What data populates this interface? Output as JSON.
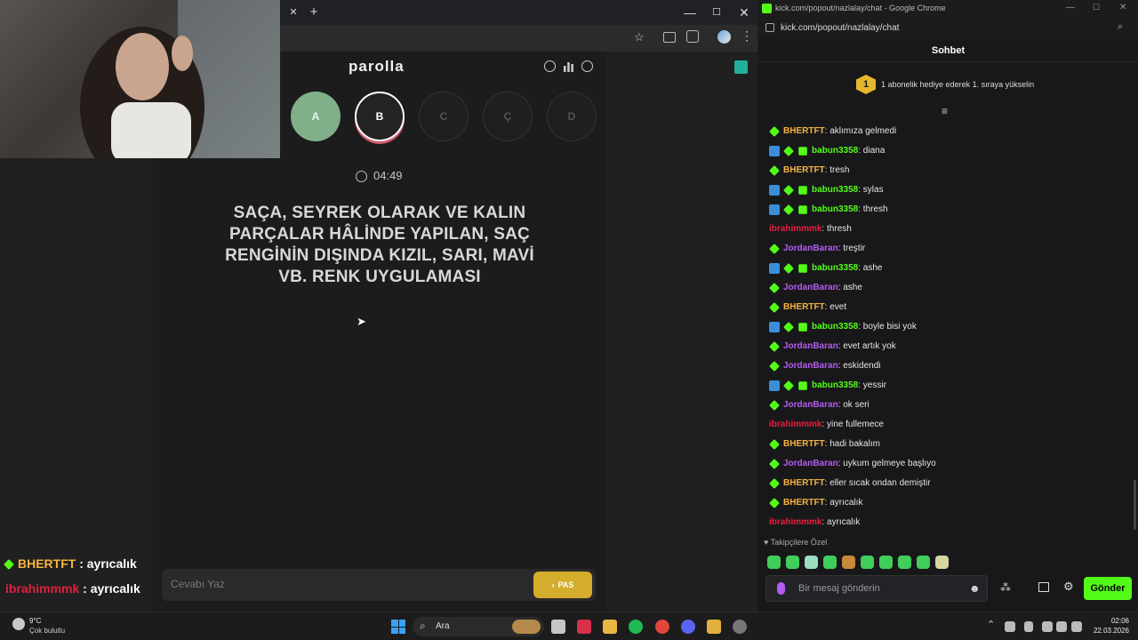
{
  "left_browser": {
    "window_controls": {
      "minimize": "—",
      "maximize": "☐",
      "close": "✕"
    },
    "tab_close": "✕",
    "new_tab": "+"
  },
  "game": {
    "title": "parolla",
    "options": [
      "A",
      "B",
      "C",
      "Ç",
      "D"
    ],
    "timer": "04:49",
    "question_lines": [
      "SAÇA, SEYREK OLARAK VE KALIN",
      "PARÇALAR HÂLİNDE YAPILAN, SAÇ",
      "RENGİNİN DIŞINDA KIZIL, SARI, MAVİ",
      "VB. RENK UYGULAMASI"
    ],
    "answer_placeholder": "Cevabı Yaz",
    "pass_button": "PAS",
    "colors": {
      "option_done": "#7fb08a",
      "option_active": "#ffffff",
      "pass": "#d4ad2c"
    }
  },
  "overlay_chat": [
    {
      "user": "BHERTFT",
      "text": " : ayrıcalık",
      "color": "#f5b540"
    },
    {
      "user": "ibrahimmmk",
      "text": " : ayrıcalık",
      "color": "#e0213f"
    }
  ],
  "chat": {
    "window_title": "kick.com/popout/nazlalay/chat - Google Chrome",
    "url": "kick.com/popout/nazlalay/chat",
    "header": "Sohbet",
    "gift_rank": "1",
    "gift_text": "1 abonelik hediye ederek 1. sıraya yükselin",
    "messages": [
      {
        "user": "BHERTFT",
        "color": "#f5b540",
        "badges": [
          "diamond"
        ],
        "text": ": aklımıza gelmedi"
      },
      {
        "user": "babun3358",
        "color": "#53fc18",
        "badges": [
          "pin",
          "diamond",
          "gift"
        ],
        "text": ": diana"
      },
      {
        "user": "BHERTFT",
        "color": "#f5b540",
        "badges": [
          "diamond"
        ],
        "text": ": tresh"
      },
      {
        "user": "babun3358",
        "color": "#53fc18",
        "badges": [
          "pin",
          "diamond",
          "gift"
        ],
        "text": ": sylas"
      },
      {
        "user": "babun3358",
        "color": "#53fc18",
        "badges": [
          "pin",
          "diamond",
          "gift"
        ],
        "text": ": thresh"
      },
      {
        "user": "ibrahimmmk",
        "color": "#e0213f",
        "badges": [],
        "text": ": thresh"
      },
      {
        "user": "JordanBaran",
        "color": "#b45cf0",
        "badges": [
          "diamond"
        ],
        "text": ": treştir"
      },
      {
        "user": "babun3358",
        "color": "#53fc18",
        "badges": [
          "pin",
          "diamond",
          "gift"
        ],
        "text": ": ashe"
      },
      {
        "user": "JordanBaran",
        "color": "#b45cf0",
        "badges": [
          "diamond"
        ],
        "text": ": ashe"
      },
      {
        "user": "BHERTFT",
        "color": "#f5b540",
        "badges": [
          "diamond"
        ],
        "text": ": evet"
      },
      {
        "user": "babun3358",
        "color": "#53fc18",
        "badges": [
          "pin",
          "diamond",
          "gift"
        ],
        "text": ": boyle bisi yok"
      },
      {
        "user": "JordanBaran",
        "color": "#b45cf0",
        "badges": [
          "diamond"
        ],
        "text": ": evet artık yok"
      },
      {
        "user": "JordanBaran",
        "color": "#b45cf0",
        "badges": [
          "diamond"
        ],
        "text": ": eskidendi"
      },
      {
        "user": "babun3358",
        "color": "#53fc18",
        "badges": [
          "pin",
          "diamond",
          "gift"
        ],
        "text": ": yessir"
      },
      {
        "user": "JordanBaran",
        "color": "#b45cf0",
        "badges": [
          "diamond"
        ],
        "text": ": ok seri"
      },
      {
        "user": "ibrahimmmk",
        "color": "#e0213f",
        "badges": [],
        "text": ": yine fullemece"
      },
      {
        "user": "BHERTFT",
        "color": "#f5b540",
        "badges": [
          "diamond"
        ],
        "text": ": hadi bakalım"
      },
      {
        "user": "JordanBaran",
        "color": "#b45cf0",
        "badges": [
          "diamond"
        ],
        "text": ": uykum gelmeye başlıyo"
      },
      {
        "user": "BHERTFT",
        "color": "#f5b540",
        "badges": [
          "diamond"
        ],
        "text": ": eller sıcak ondan demiştir"
      },
      {
        "user": "BHERTFT",
        "color": "#f5b540",
        "badges": [
          "diamond"
        ],
        "text": ": ayrıcalık"
      },
      {
        "user": "ibrahimmmk",
        "color": "#e0213f",
        "badges": [],
        "text": ": ayrıcalık"
      }
    ],
    "followers_only_label": "Takipçilere Özel",
    "input_placeholder": "Bir mesaj gönderin",
    "send_button": "Gönder",
    "accent": "#53fc18"
  },
  "taskbar": {
    "weather_temp": "9°C",
    "weather_desc": "Çok bulutlu",
    "search_label": "Ara",
    "time": "02:06",
    "date": "22.03.2026"
  }
}
